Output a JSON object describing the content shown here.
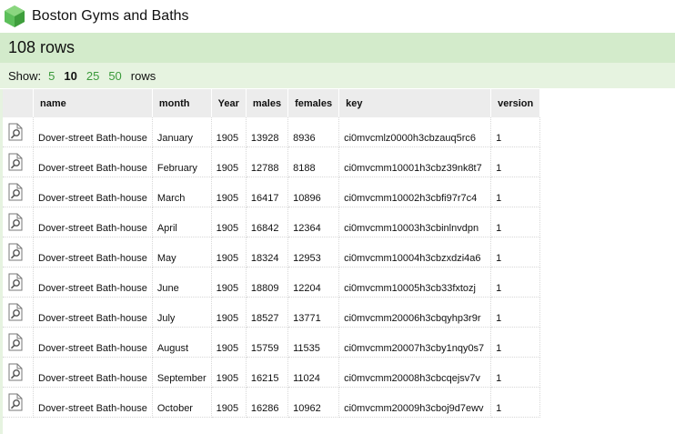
{
  "app": {
    "title": "Boston Gyms and Baths"
  },
  "summary": {
    "rows_text": "108 rows"
  },
  "pagination": {
    "show_label": "Show:",
    "options": [
      "5",
      "10",
      "25",
      "50"
    ],
    "selected": "10",
    "suffix": "rows"
  },
  "table": {
    "columns": [
      "name",
      "month",
      "Year",
      "males",
      "females",
      "key",
      "version"
    ],
    "rows": [
      [
        "Dover-street Bath-house",
        "January",
        "1905",
        "13928",
        "8936",
        "ci0mvcmlz0000h3cbzauq5rc6",
        "1"
      ],
      [
        "Dover-street Bath-house",
        "February",
        "1905",
        "12788",
        "8188",
        "ci0mvcmm10001h3cbz39nk8t7",
        "1"
      ],
      [
        "Dover-street Bath-house",
        "March",
        "1905",
        "16417",
        "10896",
        "ci0mvcmm10002h3cbfi97r7c4",
        "1"
      ],
      [
        "Dover-street Bath-house",
        "April",
        "1905",
        "16842",
        "12364",
        "ci0mvcmm10003h3cbinlnvdpn",
        "1"
      ],
      [
        "Dover-street Bath-house",
        "May",
        "1905",
        "18324",
        "12953",
        "ci0mvcmm10004h3cbzxdzi4a6",
        "1"
      ],
      [
        "Dover-street Bath-house",
        "June",
        "1905",
        "18809",
        "12204",
        "ci0mvcmm10005h3cb33fxtozj",
        "1"
      ],
      [
        "Dover-street Bath-house",
        "July",
        "1905",
        "18527",
        "13771",
        "ci0mvcmm20006h3cbqyhp3r9r",
        "1"
      ],
      [
        "Dover-street Bath-house",
        "August",
        "1905",
        "15759",
        "11535",
        "ci0mvcmm20007h3cby1nqy0s7",
        "1"
      ],
      [
        "Dover-street Bath-house",
        "September",
        "1905",
        "16215",
        "11024",
        "ci0mvcmm20008h3cbcqejsv7v",
        "1"
      ],
      [
        "Dover-street Bath-house",
        "October",
        "1905",
        "16286",
        "10962",
        "ci0mvcmm20009h3cboj9d7ewv",
        "1"
      ]
    ]
  },
  "icons": {
    "logo": "green-cube-logo-icon",
    "row_action": "document-search-icon"
  },
  "colors": {
    "header_band": "#d3ebcb",
    "show_band": "#e6f3e0",
    "link": "#3b9a3b",
    "table_header": "#ececec"
  }
}
